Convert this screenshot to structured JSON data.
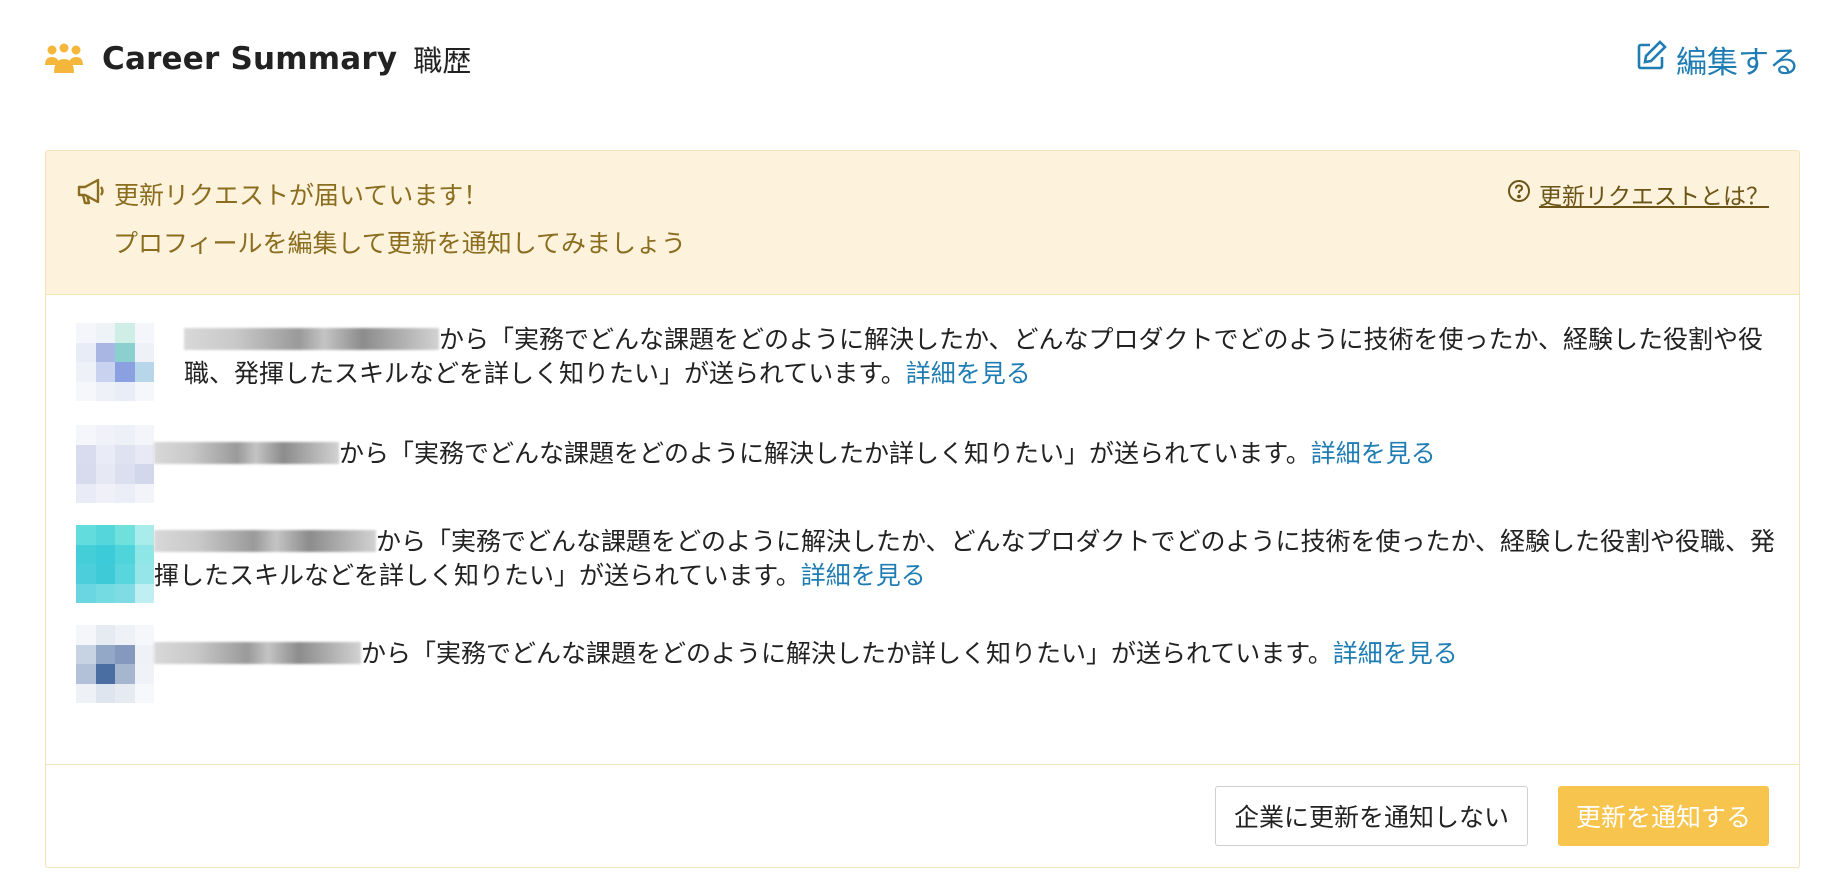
{
  "header": {
    "title": "Career Summary",
    "subtitle": "職歴",
    "edit_label": "編集する",
    "icon": "people-icon",
    "accent_color": "#f5b73b"
  },
  "notice": {
    "title": "更新リクエストが届いています！",
    "subtitle": "プロフィールを編集して更新を通知してみましょう",
    "help_label": "更新リクエストとは？",
    "background": "#fdf2dc",
    "text_color": "#8a6d1f"
  },
  "requests": [
    {
      "text": "から「実務でどんな課題をどのように解決したか、どんなプロダクトでどのように技術を使ったか、経験した役割や役職、発揮したスキルなどを詳しく知りたい」が送られています。",
      "link": "詳細を見る"
    },
    {
      "text": "から「実務でどんな課題をどのように解決したか詳しく知りたい」が送られています。",
      "link": "詳細を見る"
    },
    {
      "text": "から「実務でどんな課題をどのように解決したか、どんなプロダクトでどのように技術を使ったか、経験した役割や役職、発揮したスキルなどを詳しく知りたい」が送られています。",
      "link": "詳細を見る"
    },
    {
      "text": "から「実務でどんな課題をどのように解決したか詳しく知りたい」が送られています。",
      "link": "詳細を見る"
    }
  ],
  "footer": {
    "decline_label": "企業に更新を通知しない",
    "notify_label": "更新を通知する",
    "primary_color": "#f7c44e"
  },
  "link_color": "#1f7db3"
}
